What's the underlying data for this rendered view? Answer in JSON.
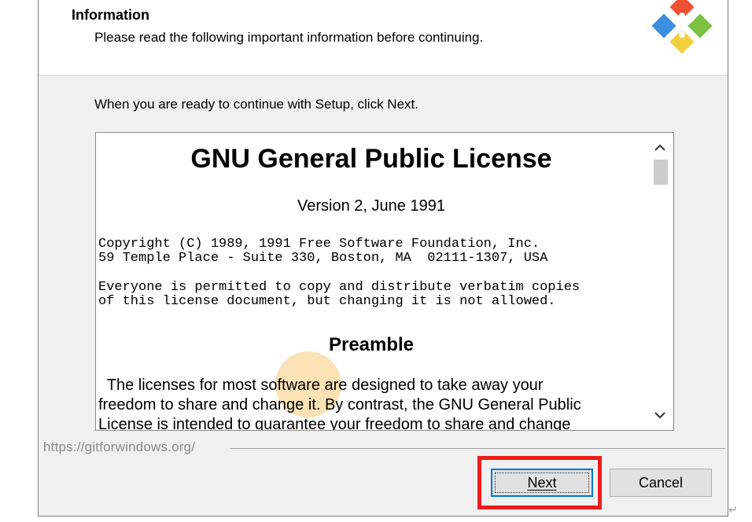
{
  "header": {
    "title": "Information",
    "subtitle": "Please read the following important information before continuing."
  },
  "intro": "When you are ready to continue with Setup, click Next.",
  "license": {
    "title": "GNU General Public License",
    "version": "Version 2, June 1991",
    "copyright": "Copyright (C) 1989, 1991 Free Software Foundation, Inc.\n59 Temple Place - Suite 330, Boston, MA  02111-1307, USA",
    "permission": "Everyone is permitted to copy and distribute verbatim copies\nof this license document, but changing it is not allowed.",
    "preamble_heading": "Preamble",
    "preamble_text": "  The licenses for most software are designed to take away your\nfreedom to share and change it. By contrast, the GNU General Public\nLicense is intended to guarantee your freedom to share and change"
  },
  "status_url": "https://gitforwindows.org/",
  "buttons": {
    "next": "Next",
    "cancel": "Cancel"
  },
  "icons": {
    "logo": "git-logo-icon",
    "scroll_up": "chevron-up-icon",
    "scroll_down": "chevron-down-icon"
  },
  "colors": {
    "highlight": "#ee1c1c",
    "focus_border": "#0078d7"
  }
}
